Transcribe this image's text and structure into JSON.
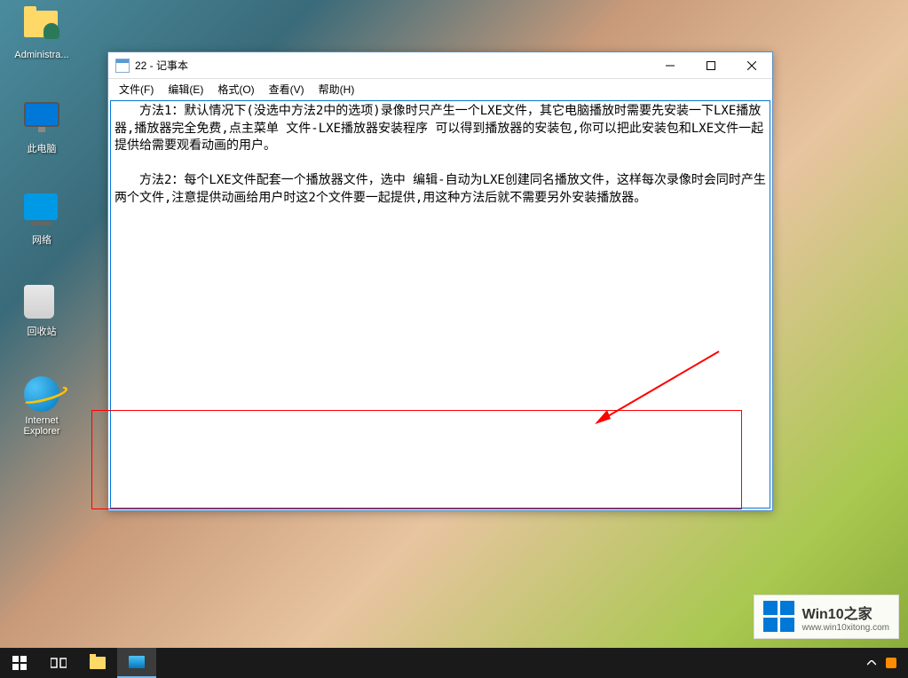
{
  "desktop": {
    "icons": [
      {
        "label": "Administra...",
        "type": "user-folder"
      },
      {
        "label": "此电脑",
        "type": "computer"
      },
      {
        "label": "网络",
        "type": "network"
      },
      {
        "label": "回收站",
        "type": "recycle"
      },
      {
        "label": "Internet Explorer",
        "type": "ie"
      }
    ]
  },
  "notepad": {
    "title": "22 - 记事本",
    "menu": {
      "file": "文件(F)",
      "edit": "编辑(E)",
      "format": "格式(O)",
      "view": "查看(V)",
      "help": "帮助(H)"
    },
    "content": "　　方法1：默认情况下(没选中方法2中的选项)录像时只产生一个LXE文件，其它电脑播放时需要先安装一下LXE播放器,播放器完全免费,点主菜单 文件-LXE播放器安装程序 可以得到播放器的安装包,你可以把此安装包和LXE文件一起提供给需要观看动画的用户。\n\n　　方法2：每个LXE文件配套一个播放器文件，选中 编辑-自动为LXE创建同名播放文件，这样每次录像时会同时产生两个文件,注意提供动画给用户时这2个文件要一起提供,用这种方法后就不需要另外安装播放器。"
  },
  "watermark": {
    "title": "Win10之家",
    "url": "www.win10xitong.com"
  }
}
